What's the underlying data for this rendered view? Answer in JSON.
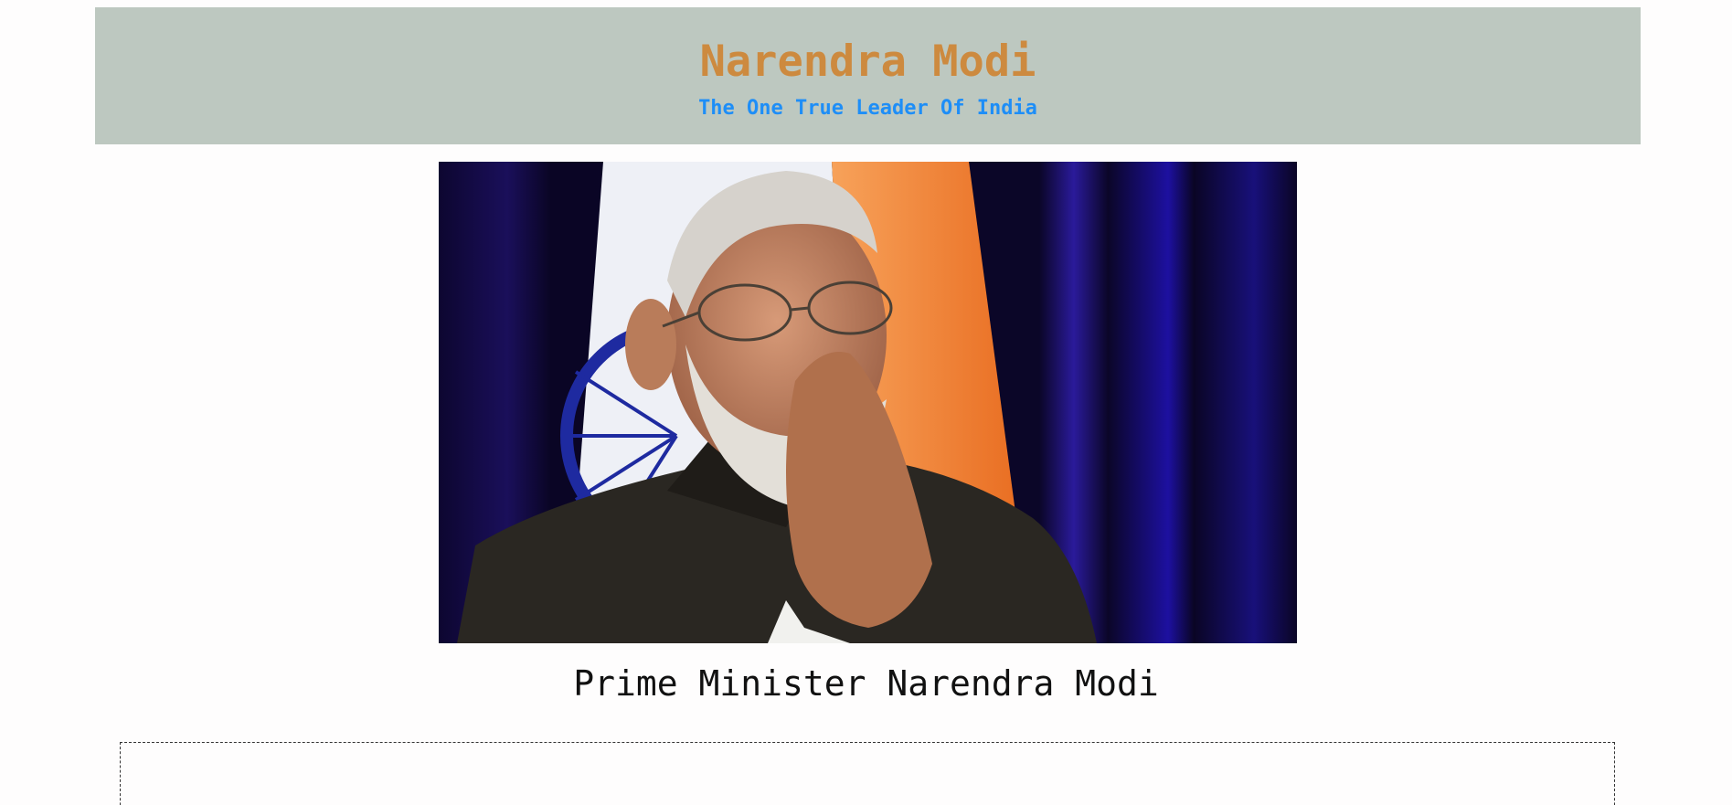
{
  "header": {
    "title": "Narendra Modi",
    "tagline": "The One True Leader Of India"
  },
  "photo": {
    "alt": "Prime Minister Narendra Modi"
  },
  "caption": "Prime Minister Narendra Modi",
  "colors": {
    "header_bg": "#bdc8c0",
    "title": "#cd8a3f",
    "tagline": "#1e8ef7",
    "page_bg": "#fefdfd"
  }
}
